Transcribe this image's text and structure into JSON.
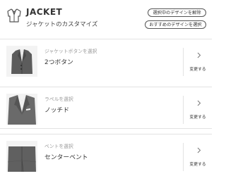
{
  "header": {
    "title": "JACKET",
    "subtitle": "ジャケットのカスタマイズ",
    "icon": "jacket-icon",
    "buttons": {
      "clear_selected": "選択中のデザインを解除",
      "select_recommended": "おすすめのデザインを選択"
    }
  },
  "options": [
    {
      "label": "ジャケットボタンを選択",
      "value": "2つボタン",
      "change_label": "変更する",
      "thumbnail": "jacket-front-photo"
    },
    {
      "label": "ラペルを選択",
      "value": "ノッチド",
      "change_label": "変更する",
      "thumbnail": "lapel-notched-photo"
    },
    {
      "label": "ベントを選択",
      "value": "センターベント",
      "change_label": "変更する",
      "thumbnail": "center-vent-photo"
    }
  ]
}
